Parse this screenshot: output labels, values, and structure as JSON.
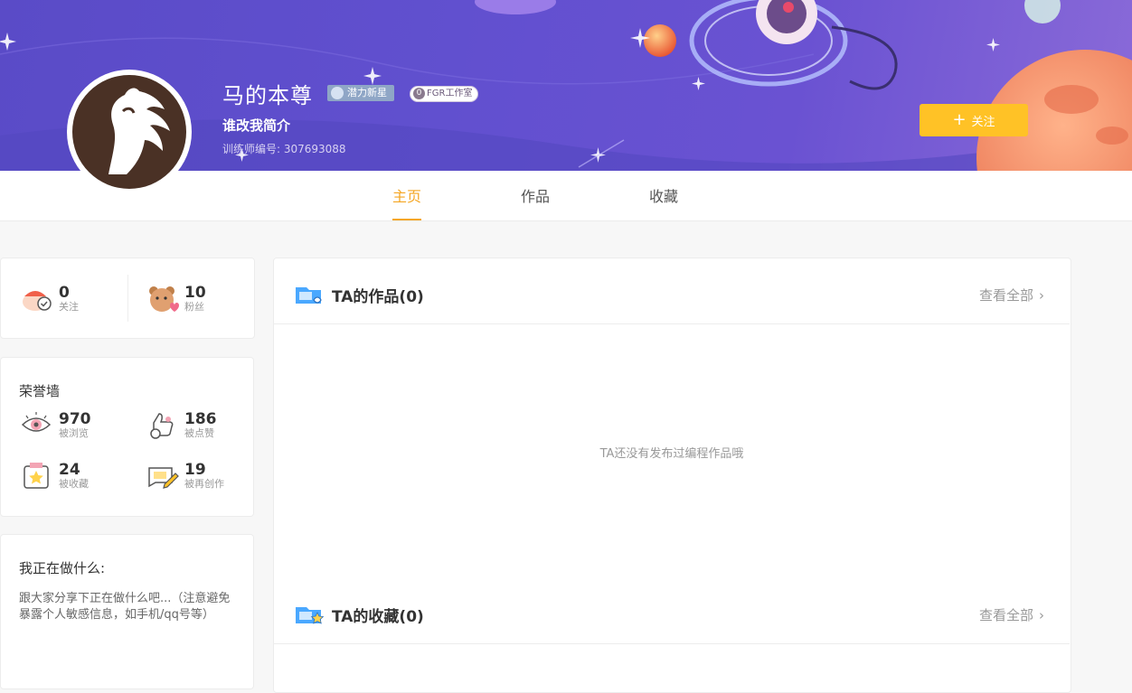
{
  "profile": {
    "name": "马的本尊",
    "badge_potential": "潜力新星",
    "badge_studio_count": "0",
    "badge_studio": "FGR工作室",
    "intro": "谁改我简介",
    "trainer_id": "训练师编号: 307693088",
    "follow_label": "关注"
  },
  "tabs": [
    "主页",
    "作品",
    "收藏"
  ],
  "social": {
    "following": {
      "value": "0",
      "label": "关注"
    },
    "fans": {
      "value": "10",
      "label": "粉丝"
    }
  },
  "honor": {
    "title": "荣誉墙",
    "items": [
      {
        "value": "970",
        "label": "被浏览",
        "icon": "eye-icon"
      },
      {
        "value": "186",
        "label": "被点赞",
        "icon": "thumbs-up-icon"
      },
      {
        "value": "24",
        "label": "被收藏",
        "icon": "star-box-icon"
      },
      {
        "value": "19",
        "label": "被再创作",
        "icon": "pencil-card-icon"
      }
    ]
  },
  "doing": {
    "title": "我正在做什么:",
    "text": "跟大家分享下正在做什么吧...（注意避免暴露个人敏感信息，如手机/qq号等）"
  },
  "works": {
    "title": "TA的作品(0)",
    "view_all": "查看全部",
    "empty_text": "TA还没有发布过编程作品哦"
  },
  "collections": {
    "title": "TA的收藏(0)",
    "view_all": "查看全部"
  },
  "colors": {
    "accent": "#ffc226",
    "tab_active": "#f5a623",
    "banner": "#5a4bc7"
  }
}
